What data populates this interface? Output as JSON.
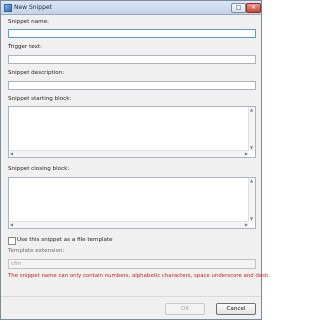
{
  "window": {
    "title": "New Snippet",
    "max_glyph": "□",
    "close_glyph": "×"
  },
  "form": {
    "name_label": "Snippet name:",
    "name_value": "",
    "trigger_label": "Trigger text:",
    "trigger_value": "",
    "description_label": "Snippet description:",
    "description_value": "",
    "start_label": "Snippet starting block:",
    "start_value": "",
    "closing_label": "Snippet closing block:",
    "closing_value": "",
    "file_template_label": "Use this snippet as a file template",
    "file_template_checked": false,
    "extension_label": "Template extension:",
    "extension_value": "cfm"
  },
  "error_message": "The snippet name can only contain numbers, alphabetic characters, space underscore and dash.",
  "buttons": {
    "ok": "OK",
    "cancel": "Cancel"
  },
  "icons": {
    "app": "snippet-app-icon",
    "scroll_up": "▲",
    "scroll_down": "▼",
    "scroll_left": "◀",
    "scroll_right": "▶"
  },
  "colors": {
    "error": "#c81e1e",
    "focus_border": "#5b9bd5"
  }
}
